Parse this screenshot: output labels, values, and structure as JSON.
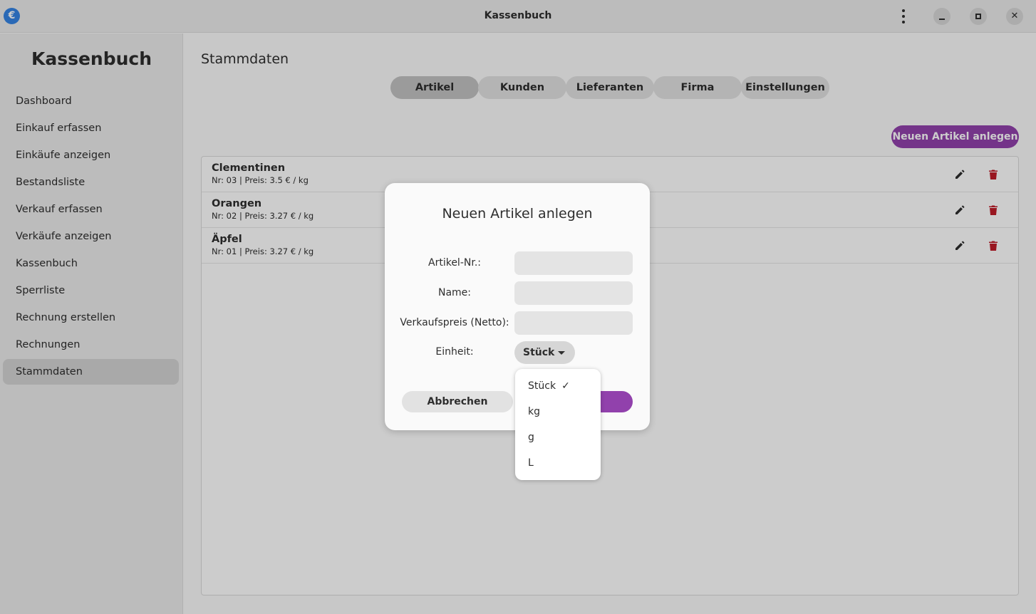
{
  "window": {
    "title": "Kassenbuch",
    "app_icon_glyph": "€"
  },
  "sidebar": {
    "title": "Kassenbuch",
    "items": [
      {
        "label": "Dashboard"
      },
      {
        "label": "Einkauf erfassen"
      },
      {
        "label": "Einkäufe anzeigen"
      },
      {
        "label": "Bestandsliste"
      },
      {
        "label": "Verkauf erfassen"
      },
      {
        "label": "Verkäufe anzeigen"
      },
      {
        "label": "Kassenbuch"
      },
      {
        "label": "Sperrliste"
      },
      {
        "label": "Rechnung erstellen"
      },
      {
        "label": "Rechnungen"
      },
      {
        "label": "Stammdaten",
        "active": true
      }
    ]
  },
  "main": {
    "title": "Stammdaten",
    "tabs": [
      {
        "label": "Artikel",
        "active": true
      },
      {
        "label": "Kunden"
      },
      {
        "label": "Lieferanten"
      },
      {
        "label": "Firma"
      },
      {
        "label": "Einstellungen"
      }
    ],
    "new_button": "Neuen Artikel anlegen",
    "articles": [
      {
        "name": "Clementinen",
        "details": "Nr: 03 | Preis: 3.5 € / kg"
      },
      {
        "name": "Orangen",
        "details": "Nr: 02 | Preis: 3.27 € / kg"
      },
      {
        "name": "Äpfel",
        "details": "Nr: 01 | Preis: 3.27 € / kg"
      }
    ]
  },
  "dialog": {
    "title": "Neuen Artikel anlegen",
    "fields": {
      "article_no": {
        "label": "Artikel-Nr.:",
        "value": ""
      },
      "name": {
        "label": "Name:",
        "value": ""
      },
      "price": {
        "label": "Verkaufspreis (Netto):",
        "value": ""
      },
      "unit": {
        "label": "Einheit:",
        "value": "Stück"
      }
    },
    "cancel": "Abbrechen"
  },
  "unit_menu": {
    "options": [
      {
        "label": "Stück",
        "selected": true,
        "check": "✓"
      },
      {
        "label": "kg"
      },
      {
        "label": "g"
      },
      {
        "label": "L"
      }
    ]
  },
  "colors": {
    "accent": "#9141ac",
    "destructive": "#c01c28",
    "app_icon": "#3584e4"
  }
}
